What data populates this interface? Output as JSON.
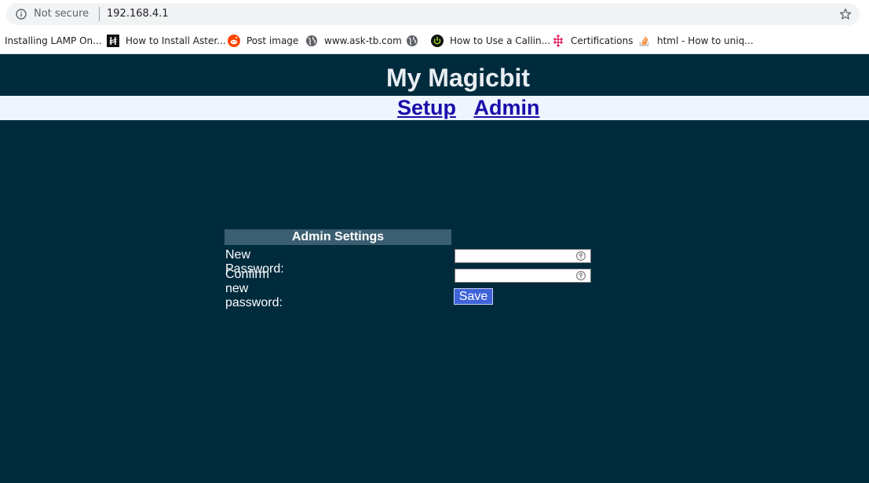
{
  "browser": {
    "security_text": "Not secure",
    "url": "192.168.4.1",
    "bookmarks": [
      {
        "label": "Installing LAMP On...",
        "icon": "none"
      },
      {
        "label": "How to Install Aster...",
        "icon": "h-icon"
      },
      {
        "label": "Post image",
        "icon": "reddit-icon"
      },
      {
        "label": "www.ask-tb.com",
        "icon": "globe-icon"
      },
      {
        "label": "",
        "icon": "globe-icon"
      },
      {
        "label": "How to Use a Callin...",
        "icon": "power-icon"
      },
      {
        "label": "Certifications",
        "icon": "diamond-grid-icon"
      },
      {
        "label": "html - How to uniq...",
        "icon": "stackoverflow-icon"
      }
    ]
  },
  "page": {
    "title": "My Magicbit",
    "nav": [
      {
        "label": "Setup"
      },
      {
        "label": "Admin"
      }
    ],
    "admin": {
      "header": "Admin Settings",
      "new_password_label": "New Password:",
      "confirm_password_label": "Confirm new password:",
      "new_password_value": "",
      "confirm_password_value": "",
      "save_label": "Save"
    }
  },
  "colors": {
    "page_bg": "#002b3d",
    "nav_bg": "#eef5ff",
    "header_bg": "#3a5f70",
    "save_bg": "#3f63d9",
    "link": "#1a0dab"
  }
}
